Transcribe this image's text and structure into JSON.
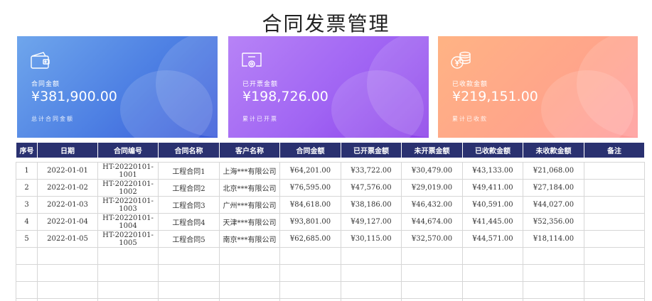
{
  "page": {
    "title": "合同发票管理"
  },
  "cards": [
    {
      "icon": "wallet-icon",
      "label": "合同金额",
      "amount": "¥381,900.00",
      "note": "总计合同金额"
    },
    {
      "icon": "invoice-certificate-icon",
      "label": "已开票金额",
      "amount": "¥198,726.00",
      "note": "累计已开票"
    },
    {
      "icon": "coins-icon",
      "label": "已收款金额",
      "amount": "¥219,151.00",
      "note": "累计已收款"
    }
  ],
  "table": {
    "headers": [
      "序号",
      "日期",
      "合同编号",
      "合同名称",
      "客户名称",
      "合同金额",
      "已开票金额",
      "未开票金额",
      "已收款金额",
      "未收款金额",
      "备注"
    ],
    "rows": [
      [
        "1",
        "2022-01-01",
        "HT-20220101-1001",
        "工程合同1",
        "上海***有限公司",
        "¥64,201.00",
        "¥33,722.00",
        "¥30,479.00",
        "¥43,133.00",
        "¥21,068.00",
        ""
      ],
      [
        "2",
        "2022-01-02",
        "HT-20220101-1002",
        "工程合同2",
        "北京***有限公司",
        "¥76,595.00",
        "¥47,576.00",
        "¥29,019.00",
        "¥49,411.00",
        "¥27,184.00",
        ""
      ],
      [
        "3",
        "2022-01-03",
        "HT-20220101-1003",
        "工程合同3",
        "广州***有限公司",
        "¥84,618.00",
        "¥38,186.00",
        "¥46,432.00",
        "¥40,591.00",
        "¥44,027.00",
        ""
      ],
      [
        "4",
        "2022-01-04",
        "HT-20220101-1004",
        "工程合同4",
        "天津***有限公司",
        "¥93,801.00",
        "¥49,127.00",
        "¥44,674.00",
        "¥41,445.00",
        "¥52,356.00",
        ""
      ],
      [
        "5",
        "2022-01-05",
        "HT-20220101-1005",
        "工程合同5",
        "南京***有限公司",
        "¥62,685.00",
        "¥30,115.00",
        "¥32,570.00",
        "¥44,571.00",
        "¥18,114.00",
        ""
      ],
      [
        "",
        "",
        "",
        "",
        "",
        "",
        "",
        "",
        "",
        "",
        ""
      ],
      [
        "",
        "",
        "",
        "",
        "",
        "",
        "",
        "",
        "",
        "",
        ""
      ],
      [
        "",
        "",
        "",
        "",
        "",
        "",
        "",
        "",
        "",
        "",
        ""
      ],
      [
        "",
        "",
        "",
        "",
        "",
        "",
        "",
        "",
        "",
        "",
        ""
      ]
    ]
  }
}
